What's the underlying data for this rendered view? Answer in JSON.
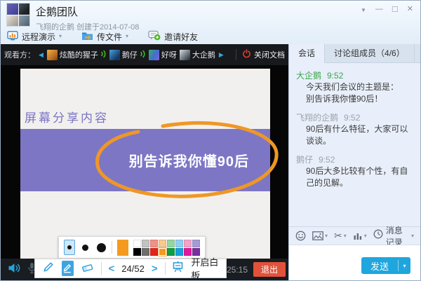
{
  "colors": {
    "accent-blue": "#2ea7e0",
    "send-blue": "#1fa6dd",
    "exit-red": "#e2523a",
    "annotation-orange": "#ef9726",
    "slide-purple": "#7d76c5",
    "name-green": "#3aa54b",
    "signal-green": "#46c31d",
    "power-red": "#e03c2e"
  },
  "window": {
    "title": "企鹅团队",
    "subtitle": "飞翔的企鹅 创建于2014-07-08"
  },
  "icons": {
    "caret": "▾",
    "menu": "▼",
    "minimize": "—",
    "maximize": "□",
    "close": "✕",
    "nav_left": "◀",
    "nav_right": "▶",
    "prev": "<",
    "next": ">",
    "scissors": "✂"
  },
  "toolbar": {
    "remote_demo": "远程演示",
    "send_file": "传文件",
    "invite_friends": "邀请好友"
  },
  "viewer_bar": {
    "label": "观看方：",
    "viewers": [
      {
        "name": "炫酷的猩子",
        "avatar_bg": "linear-gradient(135deg,#f2b34c,#b5651d 70%,#7a3c10)"
      },
      {
        "name": "鹅仔",
        "avatar_bg": "linear-gradient(135deg,#4fa0dc,#123a66 75%)"
      },
      {
        "name": "好呀",
        "avatar_bg": "linear-gradient(120deg,#3fae62,#3f6fd2 55%,#8a5fd2)"
      },
      {
        "name": "大企鹅",
        "avatar_bg": "linear-gradient(135deg,#d9dee2,#565e66 70%,#23282e)"
      }
    ],
    "close_doc": "关闭文档"
  },
  "group_avatar": {
    "tl": "linear-gradient(135deg,#6a63b8,#3b3f8e)",
    "tr": "linear-gradient(135deg,#4b555e,#1d2227 70%)",
    "bl": "linear-gradient(135deg,#e8e3d8,#9a958a)",
    "br": "linear-gradient(135deg,#8da0b0,#4d5e6c)"
  },
  "slide": {
    "heading": "屏幕分享内容",
    "banner_text": "别告诉我你懂90后"
  },
  "annotation": {
    "page": "24/52",
    "whiteboard_label": "开启白板",
    "current_color": "#f49b1f",
    "palette_row1": [
      "#ffffff",
      "#c2c2c2",
      "#f19086",
      "#f6c98e",
      "#93d6a4",
      "#8fd0f2",
      "#f2a3c7",
      "#a79bd6"
    ],
    "palette_row2": [
      "#000000",
      "#6e6e6e",
      "#e1251b",
      "#f49b1f",
      "#0f9d45",
      "#179fdb",
      "#e0189e",
      "#7b2f9f"
    ]
  },
  "bottom_bar": {
    "time": "25:15",
    "exit_label": "退出"
  },
  "chat": {
    "tabs": [
      {
        "label": "会话"
      },
      {
        "label": "讨论组成员（4/6）"
      }
    ],
    "messages": [
      {
        "name": "大企鹅",
        "time": "9:52",
        "lines": [
          "今天我们会议的主题是：",
          "别告诉我你懂90后！"
        ]
      },
      {
        "name": "飞翔的企鹅",
        "time": "9:52",
        "lines": [
          "90后有什么特征，大家可以谈谈。"
        ]
      },
      {
        "name": "鹅仔",
        "time": "9:52",
        "lines": [
          "90后大多比较有个性，有自己的见解。"
        ]
      }
    ],
    "history_label": "消息记录",
    "send_label": "发送"
  }
}
